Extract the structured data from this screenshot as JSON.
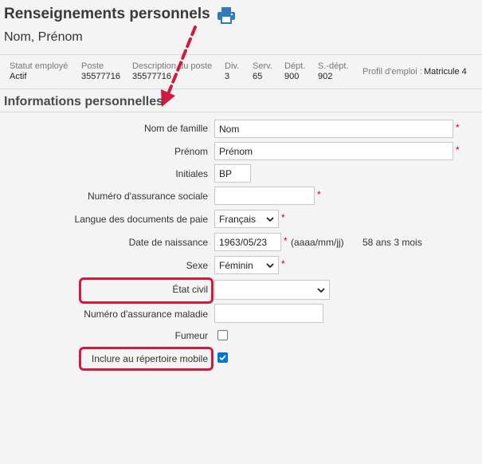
{
  "header": {
    "title": "Renseignements personnels",
    "subtitle": "Nom, Prénom"
  },
  "employee_info": {
    "columns": [
      {
        "label": "Statut employé",
        "value": "Actif"
      },
      {
        "label": "Poste",
        "value": "35577716"
      },
      {
        "label": "Description du poste",
        "value": "35577716"
      },
      {
        "label": "Div.",
        "value": "3"
      },
      {
        "label": "Serv.",
        "value": "65"
      },
      {
        "label": "Dépt.",
        "value": "900"
      },
      {
        "label": "S.-dépt.",
        "value": "902"
      }
    ],
    "profile_label": "Profil d'emploi :",
    "profile_value": "Matricule 4"
  },
  "section": {
    "title": "Informations personnelles"
  },
  "form": {
    "last_name": {
      "label": "Nom de famille",
      "value": "Nom"
    },
    "first_name": {
      "label": "Prénom",
      "value": "Prénom"
    },
    "initials": {
      "label": "Initiales",
      "value": "BP"
    },
    "sin": {
      "label": "Numéro d'assurance sociale",
      "value": ""
    },
    "pay_language": {
      "label": "Langue des documents de paie",
      "value": "Français"
    },
    "birth_date": {
      "label": "Date de naissance",
      "value": "1963/05/23",
      "format_hint": "(aaaa/mm/jj)",
      "age": "58 ans 3 mois"
    },
    "sex": {
      "label": "Sexe",
      "value": "Féminin"
    },
    "marital_status": {
      "label": "État civil",
      "value": ""
    },
    "health_insurance": {
      "label": "Numéro d'assurance maladie",
      "value": ""
    },
    "smoker": {
      "label": "Fumeur",
      "checked": false
    },
    "mobile_directory": {
      "label": "Inclure au répertoire mobile",
      "checked": true
    },
    "required_mark": "*"
  },
  "colors": {
    "highlight": "#d11a3e",
    "print_icon": "#2f7bbf",
    "required": "#d0021b",
    "checkbox_checked": "#0075d6"
  }
}
